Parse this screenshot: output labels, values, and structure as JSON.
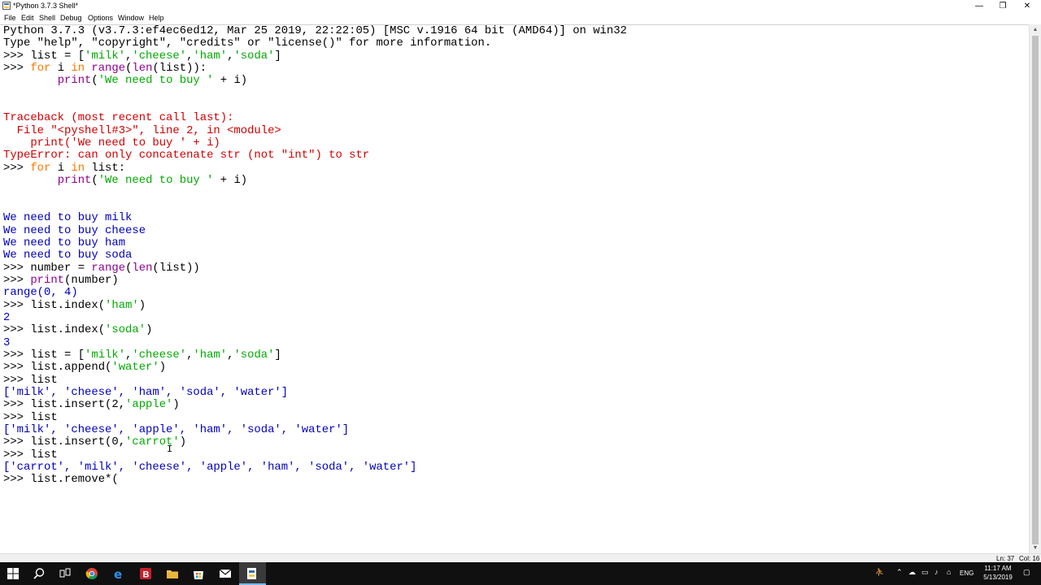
{
  "window": {
    "title": "*Python 3.7.3 Shell*",
    "minimize": "—",
    "maximize": "❐",
    "close": "✕"
  },
  "menu": [
    "File",
    "Edit",
    "Shell",
    "Debug",
    "Options",
    "Window",
    "Help"
  ],
  "shell": {
    "lines": [
      [
        {
          "c": "Python 3.7.3 (v3.7.3:ef4ec6ed12, Mar 25 2019, 22:22:05) [MSC v.1916 64 bit (AMD64)] on win32",
          "t": "plain"
        }
      ],
      [
        {
          "c": "Type \"help\", \"copyright\", \"credits\" or \"license()\" for more information.",
          "t": "plain"
        }
      ],
      [
        {
          "c": ">>> list = [",
          "t": "plain"
        },
        {
          "c": "'milk'",
          "t": "str"
        },
        {
          "c": ",",
          "t": "plain"
        },
        {
          "c": "'cheese'",
          "t": "str"
        },
        {
          "c": ",",
          "t": "plain"
        },
        {
          "c": "'ham'",
          "t": "str"
        },
        {
          "c": ",",
          "t": "plain"
        },
        {
          "c": "'soda'",
          "t": "str"
        },
        {
          "c": "]",
          "t": "plain"
        }
      ],
      [
        {
          "c": ">>> ",
          "t": "plain"
        },
        {
          "c": "for",
          "t": "kw"
        },
        {
          "c": " i ",
          "t": "plain"
        },
        {
          "c": "in",
          "t": "kw"
        },
        {
          "c": " ",
          "t": "plain"
        },
        {
          "c": "range",
          "t": "bi"
        },
        {
          "c": "(",
          "t": "plain"
        },
        {
          "c": "len",
          "t": "bi"
        },
        {
          "c": "(list)):",
          "t": "plain"
        }
      ],
      [
        {
          "c": "        ",
          "t": "plain"
        },
        {
          "c": "print",
          "t": "bi"
        },
        {
          "c": "(",
          "t": "plain"
        },
        {
          "c": "'We need to buy '",
          "t": "str"
        },
        {
          "c": " + i)",
          "t": "plain"
        }
      ],
      [],
      [],
      [
        {
          "c": "Traceback (most recent call last):",
          "t": "err"
        }
      ],
      [
        {
          "c": "  File \"<pyshell#3>\", line 2, in <module>",
          "t": "err"
        }
      ],
      [
        {
          "c": "    print('We need to buy ' + i)",
          "t": "err"
        }
      ],
      [
        {
          "c": "TypeError: can only concatenate str (not \"int\") to str",
          "t": "err"
        }
      ],
      [
        {
          "c": ">>> ",
          "t": "plain"
        },
        {
          "c": "for",
          "t": "kw"
        },
        {
          "c": " i ",
          "t": "plain"
        },
        {
          "c": "in",
          "t": "kw"
        },
        {
          "c": " list:",
          "t": "plain"
        }
      ],
      [
        {
          "c": "        ",
          "t": "plain"
        },
        {
          "c": "print",
          "t": "bi"
        },
        {
          "c": "(",
          "t": "plain"
        },
        {
          "c": "'We need to buy '",
          "t": "str"
        },
        {
          "c": " + i)",
          "t": "plain"
        }
      ],
      [],
      [],
      [
        {
          "c": "We need to buy milk",
          "t": "out"
        }
      ],
      [
        {
          "c": "We need to buy cheese",
          "t": "out"
        }
      ],
      [
        {
          "c": "We need to buy ham",
          "t": "out"
        }
      ],
      [
        {
          "c": "We need to buy soda",
          "t": "out"
        }
      ],
      [
        {
          "c": ">>> number = ",
          "t": "plain"
        },
        {
          "c": "range",
          "t": "bi"
        },
        {
          "c": "(",
          "t": "plain"
        },
        {
          "c": "len",
          "t": "bi"
        },
        {
          "c": "(list))",
          "t": "plain"
        }
      ],
      [
        {
          "c": ">>> ",
          "t": "plain"
        },
        {
          "c": "print",
          "t": "bi"
        },
        {
          "c": "(number)",
          "t": "plain"
        }
      ],
      [
        {
          "c": "range(0, 4)",
          "t": "out"
        }
      ],
      [
        {
          "c": ">>> list.index(",
          "t": "plain"
        },
        {
          "c": "'ham'",
          "t": "str"
        },
        {
          "c": ")",
          "t": "plain"
        }
      ],
      [
        {
          "c": "2",
          "t": "out"
        }
      ],
      [
        {
          "c": ">>> list.index(",
          "t": "plain"
        },
        {
          "c": "'soda'",
          "t": "str"
        },
        {
          "c": ")",
          "t": "plain"
        }
      ],
      [
        {
          "c": "3",
          "t": "out"
        }
      ],
      [
        {
          "c": ">>> list = [",
          "t": "plain"
        },
        {
          "c": "'milk'",
          "t": "str"
        },
        {
          "c": ",",
          "t": "plain"
        },
        {
          "c": "'cheese'",
          "t": "str"
        },
        {
          "c": ",",
          "t": "plain"
        },
        {
          "c": "'ham'",
          "t": "str"
        },
        {
          "c": ",",
          "t": "plain"
        },
        {
          "c": "'soda'",
          "t": "str"
        },
        {
          "c": "]",
          "t": "plain"
        }
      ],
      [
        {
          "c": ">>> list.append(",
          "t": "plain"
        },
        {
          "c": "'water'",
          "t": "str"
        },
        {
          "c": ")",
          "t": "plain"
        }
      ],
      [
        {
          "c": ">>> list",
          "t": "plain"
        }
      ],
      [
        {
          "c": "['milk', 'cheese', 'ham', 'soda', 'water']",
          "t": "out"
        }
      ],
      [
        {
          "c": ">>> list.insert(2,",
          "t": "plain"
        },
        {
          "c": "'apple'",
          "t": "str"
        },
        {
          "c": ")",
          "t": "plain"
        }
      ],
      [
        {
          "c": ">>> list",
          "t": "plain"
        }
      ],
      [
        {
          "c": "['milk', 'cheese', 'apple', 'ham', 'soda', 'water']",
          "t": "out"
        }
      ],
      [
        {
          "c": ">>> list.insert(0,",
          "t": "plain"
        },
        {
          "c": "'carrot'",
          "t": "str"
        },
        {
          "c": ")",
          "t": "plain"
        }
      ],
      [
        {
          "c": ">>> list",
          "t": "plain"
        }
      ],
      [
        {
          "c": "['carrot', 'milk', 'cheese', 'apple', 'ham', 'soda', 'water']",
          "t": "out"
        }
      ],
      [
        {
          "c": ">>> list.remove*(",
          "t": "plain"
        }
      ]
    ]
  },
  "status": {
    "ln": "Ln: 37",
    "col": "Col: 16"
  },
  "taskbar": {
    "apps": [
      "windows-start-icon",
      "search-icon",
      "task-view-icon",
      "chrome-icon",
      "edge-icon",
      "b-app-icon",
      "file-explorer-icon",
      "store-icon",
      "mail-icon",
      "idle-python-icon"
    ],
    "language": "ENG",
    "time": "11:17 AM",
    "date": "5/13/2019"
  },
  "colors": {
    "output": "#0000c0",
    "error": "#d00000",
    "keyword": "#ff7700",
    "builtin": "#900090",
    "string": "#00aa00",
    "taskbar": "#101010"
  }
}
